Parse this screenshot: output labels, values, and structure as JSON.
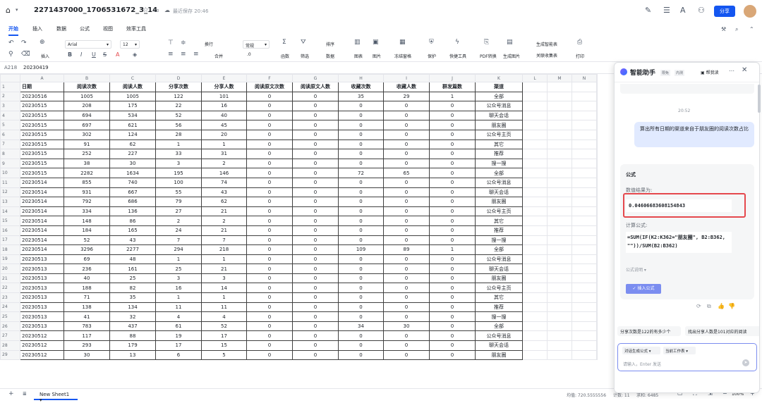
{
  "titlebar": {
    "home_icon": "home-icon",
    "filename": "2271437000_1706531672_3_14",
    "save_status": "最近保存 20:46",
    "share_label": "分享"
  },
  "ribbon_tabs": [
    "开始",
    "插入",
    "数据",
    "公式",
    "视图",
    "效率工具"
  ],
  "ribbon": {
    "insert": "插入",
    "font": "Arial",
    "font_size": "12",
    "wrap": "换行",
    "merge": "合并",
    "number_format": "常规",
    "decimal": ".0",
    "function": "函数",
    "filter": "筛选",
    "sort": "排序",
    "data": "数据",
    "chart": "图表",
    "image": "图片",
    "freeze": "冻结窗格",
    "protect": "保护",
    "quick_tools": "快捷工具",
    "pdf": "PDF转换",
    "gen_image": "生成图片",
    "gen_smart_table": "生成智能表",
    "assoc_table": "关联收集表",
    "print": "打印"
  },
  "formula_bar": {
    "cell_ref": "A218",
    "value": "20230419"
  },
  "columns": [
    "A",
    "B",
    "C",
    "D",
    "E",
    "F",
    "G",
    "H",
    "I",
    "J",
    "K",
    "L",
    "M",
    "N"
  ],
  "table": {
    "headers": [
      "日期",
      "阅读次数",
      "阅读人数",
      "分享次数",
      "分享人数",
      "阅读原文次数",
      "阅读原文人数",
      "收藏次数",
      "收藏人数",
      "群发篇数",
      "渠道"
    ],
    "rows": [
      [
        "20230516",
        "1005",
        "1005",
        "122",
        "101",
        "0",
        "0",
        "35",
        "29",
        "1",
        "全部"
      ],
      [
        "20230515",
        "208",
        "175",
        "22",
        "16",
        "0",
        "0",
        "0",
        "0",
        "0",
        "公众号消息"
      ],
      [
        "20230515",
        "694",
        "534",
        "52",
        "40",
        "0",
        "0",
        "0",
        "0",
        "0",
        "聊天会话"
      ],
      [
        "20230515",
        "697",
        "621",
        "56",
        "45",
        "0",
        "0",
        "0",
        "0",
        "0",
        "朋友圈"
      ],
      [
        "20230515",
        "302",
        "124",
        "28",
        "20",
        "0",
        "0",
        "0",
        "0",
        "0",
        "公众号主页"
      ],
      [
        "20230515",
        "91",
        "62",
        "1",
        "1",
        "0",
        "0",
        "0",
        "0",
        "0",
        "其它"
      ],
      [
        "20230515",
        "252",
        "227",
        "33",
        "31",
        "0",
        "0",
        "0",
        "0",
        "0",
        "推荐"
      ],
      [
        "20230515",
        "38",
        "30",
        "3",
        "2",
        "0",
        "0",
        "0",
        "0",
        "0",
        "搜一搜"
      ],
      [
        "20230515",
        "2282",
        "1634",
        "195",
        "146",
        "0",
        "0",
        "72",
        "65",
        "0",
        "全部"
      ],
      [
        "20230514",
        "855",
        "740",
        "100",
        "74",
        "0",
        "0",
        "0",
        "0",
        "0",
        "公众号消息"
      ],
      [
        "20230514",
        "931",
        "667",
        "55",
        "43",
        "0",
        "0",
        "0",
        "0",
        "0",
        "聊天会话"
      ],
      [
        "20230514",
        "792",
        "686",
        "79",
        "62",
        "0",
        "0",
        "0",
        "0",
        "0",
        "朋友圈"
      ],
      [
        "20230514",
        "334",
        "136",
        "27",
        "21",
        "0",
        "0",
        "0",
        "0",
        "0",
        "公众号主页"
      ],
      [
        "20230514",
        "148",
        "86",
        "2",
        "2",
        "0",
        "0",
        "0",
        "0",
        "0",
        "其它"
      ],
      [
        "20230514",
        "184",
        "165",
        "24",
        "21",
        "0",
        "0",
        "0",
        "0",
        "0",
        "推荐"
      ],
      [
        "20230514",
        "52",
        "43",
        "7",
        "7",
        "0",
        "0",
        "0",
        "0",
        "0",
        "搜一搜"
      ],
      [
        "20230514",
        "3296",
        "2277",
        "294",
        "218",
        "0",
        "0",
        "109",
        "89",
        "1",
        "全部"
      ],
      [
        "20230513",
        "69",
        "48",
        "1",
        "1",
        "0",
        "0",
        "0",
        "0",
        "0",
        "公众号消息"
      ],
      [
        "20230513",
        "236",
        "161",
        "25",
        "21",
        "0",
        "0",
        "0",
        "0",
        "0",
        "聊天会话"
      ],
      [
        "20230513",
        "40",
        "25",
        "3",
        "3",
        "0",
        "0",
        "0",
        "0",
        "0",
        "朋友圈"
      ],
      [
        "20230513",
        "188",
        "82",
        "16",
        "14",
        "0",
        "0",
        "0",
        "0",
        "0",
        "公众号主页"
      ],
      [
        "20230513",
        "71",
        "35",
        "1",
        "1",
        "0",
        "0",
        "0",
        "0",
        "0",
        "其它"
      ],
      [
        "20230513",
        "138",
        "134",
        "11",
        "11",
        "0",
        "0",
        "0",
        "0",
        "0",
        "推荐"
      ],
      [
        "20230513",
        "41",
        "32",
        "4",
        "4",
        "0",
        "0",
        "0",
        "0",
        "0",
        "搜一搜"
      ],
      [
        "20230513",
        "783",
        "437",
        "61",
        "52",
        "0",
        "0",
        "34",
        "30",
        "0",
        "全部"
      ],
      [
        "20230512",
        "117",
        "88",
        "19",
        "17",
        "0",
        "0",
        "0",
        "0",
        "0",
        "公众号消息"
      ],
      [
        "20230512",
        "293",
        "179",
        "17",
        "15",
        "0",
        "0",
        "0",
        "0",
        "0",
        "聊天会话"
      ],
      [
        "20230512",
        "30",
        "13",
        "6",
        "5",
        "0",
        "0",
        "0",
        "0",
        "0",
        "朋友圈"
      ]
    ]
  },
  "statusbar": {
    "sheet_name": "New Sheet1",
    "avg": "均值: 720.5555556",
    "count": "计数: 11",
    "sum": "求和: 6485",
    "zoom": "100%"
  },
  "assistant": {
    "title": "智能助手",
    "badge1": "限免",
    "badge2": "内测",
    "help": "帮我读",
    "time": "20:52",
    "user_message": "算出所有日期的渠道来自于朋友圈的阅读次数占比",
    "result_heading": "公式",
    "value_label": "数值结果为:",
    "value": "0.04606683608154843",
    "formula_label": "计算公式:",
    "formula": "=SUM(IF(K2:K362=\"朋友圈\", B2:B362, \"\"))/SUM(B2:B362)",
    "explain": "公式说明",
    "insert_button": "插入公式",
    "suggestion1": "分享次数是122的有多少个",
    "suggestion2": "找出分享人数是101对应的阅读",
    "mode": "对话生成公式",
    "scope": "当前工作表",
    "input_placeholder": "请输入，Enter 发送"
  },
  "colors": {
    "accent": "#1456f0",
    "highlight_box": "#e5484d"
  }
}
